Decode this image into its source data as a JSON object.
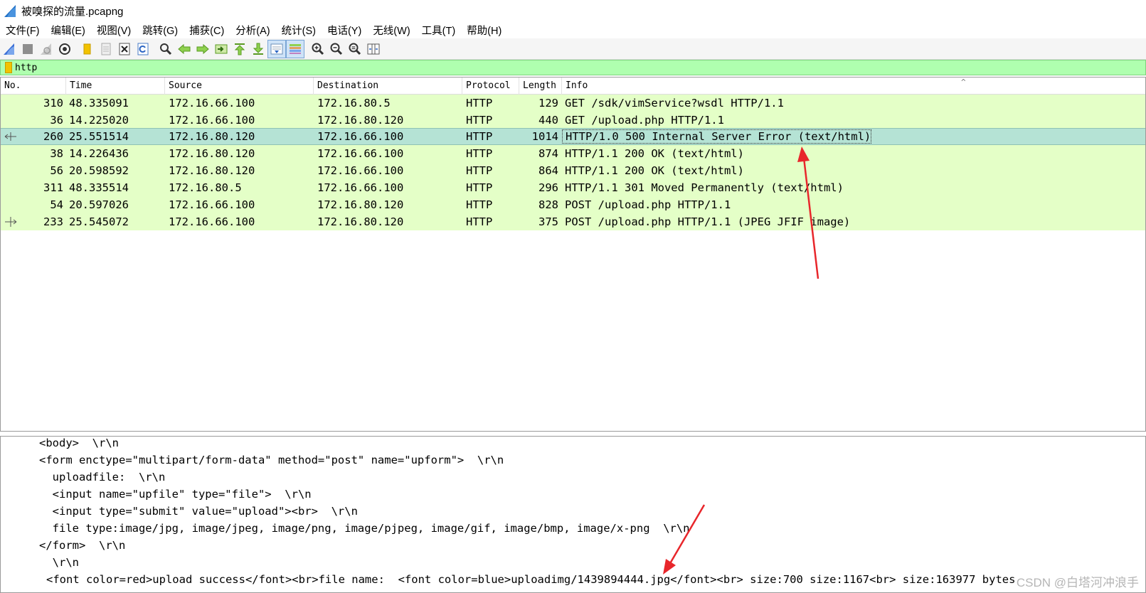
{
  "window": {
    "title": "被嗅探的流量.pcapng"
  },
  "menu": [
    "文件(F)",
    "编辑(E)",
    "视图(V)",
    "跳转(G)",
    "捕获(C)",
    "分析(A)",
    "统计(S)",
    "电话(Y)",
    "无线(W)",
    "工具(T)",
    "帮助(H)"
  ],
  "toolbar": {
    "buttons": [
      "shark-fin-start",
      "stop-square",
      "restart-fin",
      "capture-options-gear",
      "open-folder",
      "save-file",
      "close-file",
      "reload",
      "find-magnifier",
      "go-back-arrow",
      "go-forward-arrow",
      "go-to-packet",
      "first-packet",
      "last-packet",
      "autoscroll",
      "colorize",
      "zoom-in",
      "zoom-out",
      "zoom-normal",
      "resize-columns"
    ]
  },
  "filter": {
    "value": "http"
  },
  "packet_list": {
    "columns": [
      "No.",
      "Time",
      "Source",
      "Destination",
      "Protocol",
      "Length",
      "Info"
    ],
    "sort_caret": "^",
    "rows": [
      {
        "no": "310",
        "time": "48.335091",
        "src": "172.16.66.100",
        "dst": "172.16.80.5",
        "proto": "HTTP",
        "len": "129",
        "info": "GET /sdk/vimService?wsdl HTTP/1.1"
      },
      {
        "no": "36",
        "time": "14.225020",
        "src": "172.16.66.100",
        "dst": "172.16.80.120",
        "proto": "HTTP",
        "len": "440",
        "info": "GET /upload.php HTTP/1.1"
      },
      {
        "no": "260",
        "time": "25.551514",
        "src": "172.16.80.120",
        "dst": "172.16.66.100",
        "proto": "HTTP",
        "len": "1014",
        "info": "HTTP/1.0 500 Internal Server Error  (text/html)"
      },
      {
        "no": "38",
        "time": "14.226436",
        "src": "172.16.80.120",
        "dst": "172.16.66.100",
        "proto": "HTTP",
        "len": "874",
        "info": "HTTP/1.1 200 OK  (text/html)"
      },
      {
        "no": "56",
        "time": "20.598592",
        "src": "172.16.80.120",
        "dst": "172.16.66.100",
        "proto": "HTTP",
        "len": "864",
        "info": "HTTP/1.1 200 OK  (text/html)"
      },
      {
        "no": "311",
        "time": "48.335514",
        "src": "172.16.80.5",
        "dst": "172.16.66.100",
        "proto": "HTTP",
        "len": "296",
        "info": "HTTP/1.1 301 Moved Permanently  (text/html)"
      },
      {
        "no": "54",
        "time": "20.597026",
        "src": "172.16.66.100",
        "dst": "172.16.80.120",
        "proto": "HTTP",
        "len": "828",
        "info": "POST /upload.php HTTP/1.1"
      },
      {
        "no": "233",
        "time": "25.545072",
        "src": "172.16.66.100",
        "dst": "172.16.80.120",
        "proto": "HTTP",
        "len": "375",
        "info": "POST /upload.php HTTP/1.1  (JPEG JFIF image)"
      }
    ]
  },
  "detail_lines": [
    "<body>  \\r\\n",
    "<form enctype=\"multipart/form-data\" method=\"post\" name=\"upform\">  \\r\\n",
    "  uploadfile:  \\r\\n",
    "  <input name=\"upfile\" type=\"file\">  \\r\\n",
    "  <input type=\"submit\" value=\"upload\"><br>  \\r\\n",
    "  file type:image/jpg, image/jpeg, image/png, image/pjpeg, image/gif, image/bmp, image/x-png  \\r\\n",
    "</form>  \\r\\n",
    "  \\r\\n",
    "<font color=red>upload success</font><br>file name:  <font color=blue>uploadimg/1439894444.jpg</font><br> size:700 size:1167<br> size:163977 bytes"
  ],
  "watermark": "CSDN @白塔河冲浪手",
  "colors": {
    "row_bg": "#e4ffc7",
    "selected_row_bg": "#b5e3d5",
    "filter_bg": "#afffaf",
    "annotation_arrow": "#e8262b"
  }
}
